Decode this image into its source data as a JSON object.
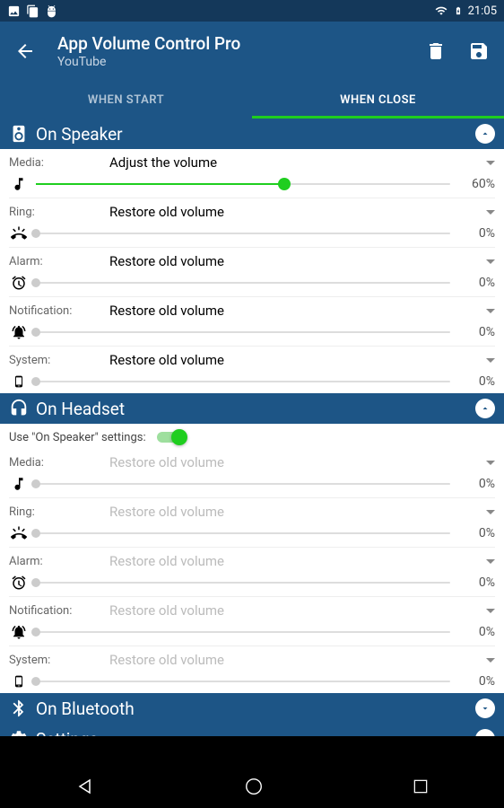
{
  "status": {
    "time": "21:05"
  },
  "appbar": {
    "title": "App Volume Control Pro",
    "subtitle": "YouTube"
  },
  "tabs": {
    "start": "WHEN START",
    "close": "WHEN CLOSE"
  },
  "sections": {
    "speaker": {
      "title": "On Speaker"
    },
    "headset": {
      "title": "On Headset",
      "use_speaker_label": "Use \"On Speaker\" settings:"
    },
    "bluetooth": {
      "title": "On Bluetooth"
    },
    "settings": {
      "title": "Settings"
    }
  },
  "labels": {
    "media": "Media:",
    "ring": "Ring:",
    "alarm": "Alarm:",
    "notification": "Notification:",
    "system": "System:"
  },
  "actions": {
    "adjust": "Adjust the volume",
    "restore": "Restore old volume"
  },
  "speaker_vals": {
    "media": {
      "pct": "60%",
      "val": 60
    },
    "ring": {
      "pct": "0%",
      "val": 0
    },
    "alarm": {
      "pct": "0%",
      "val": 0
    },
    "notification": {
      "pct": "0%",
      "val": 0
    },
    "system": {
      "pct": "0%",
      "val": 0
    }
  },
  "headset_vals": {
    "media": {
      "pct": "0%",
      "val": 0
    },
    "ring": {
      "pct": "0%",
      "val": 0
    },
    "alarm": {
      "pct": "0%",
      "val": 0
    },
    "notification": {
      "pct": "0%",
      "val": 0
    },
    "system": {
      "pct": "0%",
      "val": 0
    }
  }
}
